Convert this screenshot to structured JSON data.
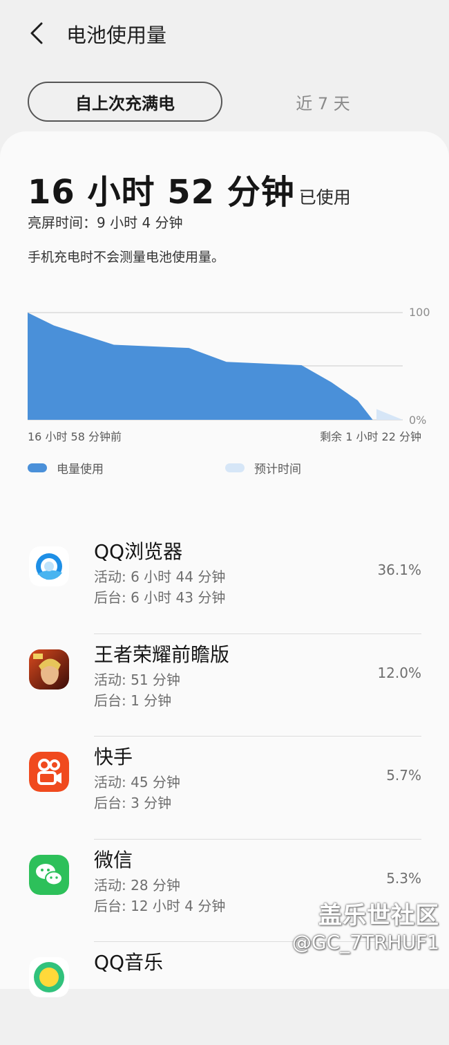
{
  "header": {
    "title": "电池使用量",
    "back_icon": "chevron-left-icon"
  },
  "tabs": [
    {
      "label": "自上次充满电",
      "selected": true
    },
    {
      "label": "近 7 天",
      "selected": false
    }
  ],
  "summary": {
    "usage_time": "16 小时 52 分钟",
    "usage_suffix": "已使用",
    "screen_time": "亮屏时间：9 小时 4 分钟",
    "note": "手机充电时不会测量电池使用量。"
  },
  "chart": {
    "x_left": "16 小时 58 分钟前",
    "x_right": "剩余 1 小时 22 分钟",
    "legend_used": "电量使用",
    "legend_estimate": "预计时间",
    "colors": {
      "used": "#4a90d9",
      "estimate": "#d6e6f7"
    }
  },
  "chart_data": {
    "type": "area",
    "y_ticks": [
      "100",
      "0%"
    ],
    "ylim": [
      0,
      100
    ],
    "x_range": [
      "16 小时 58 分钟前",
      "剩余 1 小时 22 分钟"
    ],
    "grid": true,
    "legend": "bottom",
    "series": [
      {
        "name": "电量使用",
        "x": [
          0,
          0.07,
          0.23,
          0.43,
          0.53,
          0.73,
          0.81,
          0.88,
          0.92
        ],
        "y": [
          100,
          88,
          70,
          67,
          54,
          51,
          35,
          18,
          0
        ]
      },
      {
        "name": "预计时间",
        "x": [
          0.93,
          1.0
        ],
        "y": [
          10,
          0
        ]
      }
    ]
  },
  "apps": [
    {
      "name": "QQ浏览器",
      "active": "活动: 6 小时 44 分钟",
      "background": "后台: 6 小时 43 分钟",
      "percent": "36.1%",
      "icon": "qq-browser-icon"
    },
    {
      "name": "王者荣耀前瞻版",
      "active": "活动: 51 分钟",
      "background": "后台: 1 分钟",
      "percent": "12.0%",
      "icon": "honor-of-kings-icon"
    },
    {
      "name": "快手",
      "active": "活动: 45 分钟",
      "background": "后台: 3 分钟",
      "percent": "5.7%",
      "icon": "kuaishou-icon"
    },
    {
      "name": "微信",
      "active": "活动: 28 分钟",
      "background": "后台: 12 小时 4 分钟",
      "percent": "5.3%",
      "icon": "wechat-icon"
    },
    {
      "name": "QQ音乐",
      "active": "",
      "background": "",
      "percent": "",
      "icon": "qq-music-icon"
    }
  ],
  "watermark": {
    "site": "盖乐世社区",
    "user": "@GC_7TRHUF1"
  }
}
